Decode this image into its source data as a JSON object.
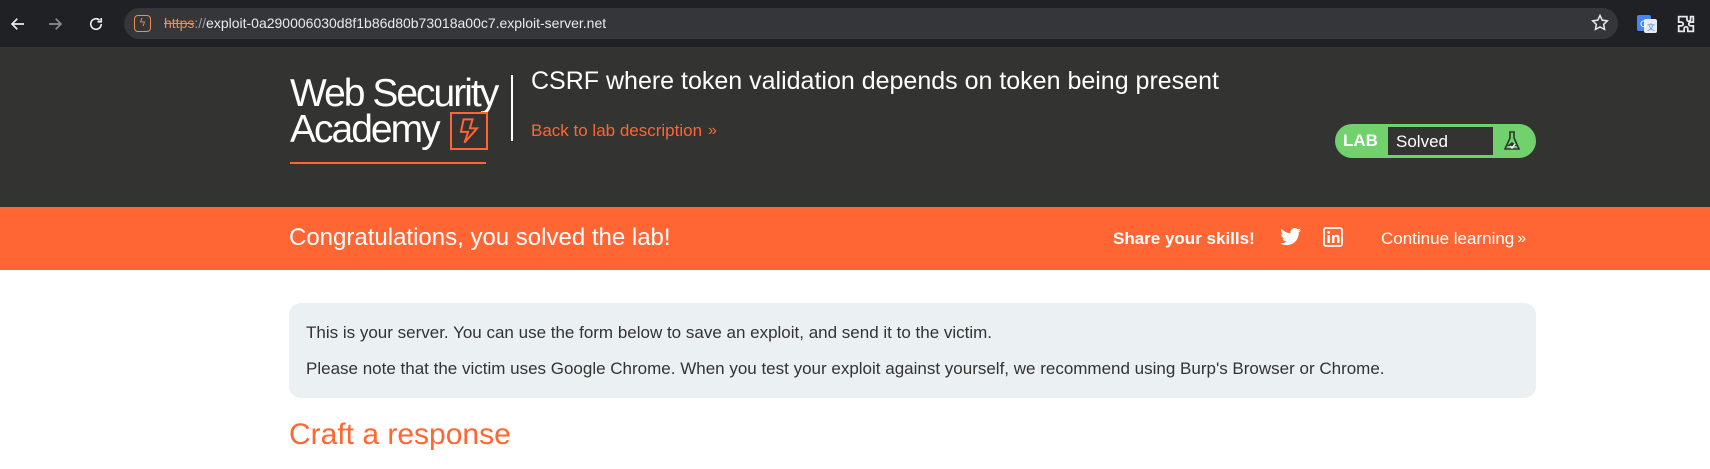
{
  "browser": {
    "url_scheme": "https",
    "url_separator": "://",
    "url_host": "exploit-0a290006030d8f1b86d80b73018a00c7.exploit-server.net",
    "icons": [
      "back-arrow-icon",
      "forward-arrow-icon",
      "reload-icon",
      "site-favicon-icon",
      "bookmark-star-icon",
      "google-translate-icon",
      "extensions-icon"
    ]
  },
  "header": {
    "logo_line1": "Web Security",
    "logo_line2": "Academy",
    "lab_title": "CSRF where token validation depends on token being present",
    "back_link": "Back to lab description",
    "back_chevron": "»",
    "status_label": "LAB",
    "status_value": "Solved"
  },
  "banner": {
    "message": "Congratulations, you solved the lab!",
    "share_label": "Share your skills!",
    "continue_link": "Continue learning",
    "continue_chevron": "»"
  },
  "main": {
    "info_line1": "This is your server. You can use the form below to save an exploit, and send it to the victim.",
    "info_line2": "Please note that the victim uses Google Chrome. When you test your exploit against yourself, we recommend using Burp's Browser or Chrome.",
    "section_title": "Craft a response"
  },
  "colors": {
    "accent_orange": "#ff6633",
    "header_dark": "#333332",
    "solved_green": "#70d16d",
    "info_bg": "#ebf0f2"
  }
}
